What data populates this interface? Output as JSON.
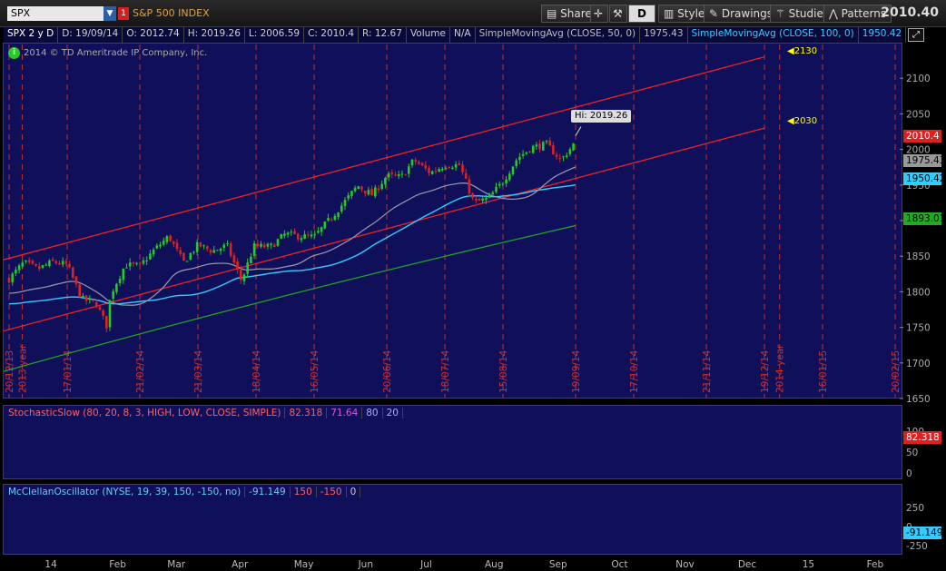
{
  "toolbar": {
    "symbol": "SPX",
    "symbol_name": "S&P 500 INDEX",
    "link_badge": "1",
    "share_label": "Share",
    "period_label": "D",
    "style_label": "Style",
    "drawings_label": "Drawings",
    "studies_label": "Studies",
    "patterns_label": "Patterns",
    "last_price": "2010.40"
  },
  "info": {
    "title": "SPX 2 y D",
    "date": "D: 19/09/14",
    "open": "O: 2012.74",
    "high": "H: 2019.26",
    "low": "L: 2006.59",
    "close": "C: 2010.4",
    "range": "R: 12.67",
    "volume_label": "Volume",
    "volume_value": "N/A",
    "sma50_label": "SimpleMovingAvg (CLOSE, 50, 0)",
    "sma50_value": "1975.43",
    "sma100_label": "SimpleMovingAvg (CLOSE, 100, 0)",
    "sma100_value": "1950.42",
    "more": "...",
    "copyright": "2014 © TD Ameritrade IP Company, Inc."
  },
  "colors": {
    "panel_bg": "#10105a",
    "up_candle": "#22cc22",
    "down_candle": "#dd2222",
    "channel": "#ff2020",
    "sma50": "#9a9ab0",
    "sma100": "#33ccff",
    "sma200": "#22aa22",
    "stoch_k": "#ff3030",
    "stoch_d": "#cc44cc",
    "mcclellan": "#33bbdd"
  },
  "chart_data": [
    {
      "type": "candlestick",
      "ylim": [
        1650,
        2150
      ],
      "y_ticks": [
        1650,
        1700,
        1750,
        1800,
        1850,
        1900,
        1950,
        2000,
        2050,
        2100
      ],
      "date_labels": [
        "20/12/13",
        "17/01/14",
        "21/02/14",
        "21/03/14",
        "18/04/14",
        "16/05/14",
        "20/06/14",
        "18/07/14",
        "15/08/14",
        "19/09/14",
        "17/10/14",
        "21/11/14",
        "19/12/14",
        "16/01/15",
        "20/02/15"
      ],
      "year_labels": [
        "2013 year",
        "2014 year"
      ],
      "close_series": [
        [
          "2013-12-20",
          1818
        ],
        [
          "2013-12-27",
          1841
        ],
        [
          "2014-01-03",
          1832
        ],
        [
          "2014-01-10",
          1842
        ],
        [
          "2014-01-17",
          1838
        ],
        [
          "2014-01-24",
          1790
        ],
        [
          "2014-01-31",
          1783
        ],
        [
          "2014-02-05",
          1752
        ],
        [
          "2014-02-07",
          1797
        ],
        [
          "2014-02-14",
          1838
        ],
        [
          "2014-02-21",
          1836
        ],
        [
          "2014-02-28",
          1859
        ],
        [
          "2014-03-07",
          1878
        ],
        [
          "2014-03-14",
          1841
        ],
        [
          "2014-03-21",
          1866
        ],
        [
          "2014-03-28",
          1857
        ],
        [
          "2014-04-04",
          1865
        ],
        [
          "2014-04-11",
          1815
        ],
        [
          "2014-04-17",
          1864
        ],
        [
          "2014-04-25",
          1863
        ],
        [
          "2014-05-02",
          1881
        ],
        [
          "2014-05-09",
          1878
        ],
        [
          "2014-05-16",
          1877
        ],
        [
          "2014-05-23",
          1900
        ],
        [
          "2014-05-30",
          1924
        ],
        [
          "2014-06-06",
          1949
        ],
        [
          "2014-06-13",
          1936
        ],
        [
          "2014-06-20",
          1963
        ],
        [
          "2014-06-27",
          1961
        ],
        [
          "2014-07-03",
          1985
        ],
        [
          "2014-07-11",
          1967
        ],
        [
          "2014-07-18",
          1978
        ],
        [
          "2014-07-25",
          1978
        ],
        [
          "2014-08-01",
          1925
        ],
        [
          "2014-08-08",
          1931
        ],
        [
          "2014-08-15",
          1955
        ],
        [
          "2014-08-22",
          1988
        ],
        [
          "2014-08-29",
          2003
        ],
        [
          "2014-09-05",
          2007
        ],
        [
          "2014-09-12",
          1985
        ],
        [
          "2014-09-19",
          2010.4
        ]
      ],
      "high_marker": 2019.26,
      "annotations": [
        "Hi: 2019.26",
        "2130",
        "2030"
      ],
      "price_tags": [
        "2010.4",
        "1975.43",
        "1950.42",
        "1893.01"
      ],
      "series": [
        {
          "name": "SimpleMovingAvg (CLOSE, 50, 0)",
          "last": 1975.43
        },
        {
          "name": "SimpleMovingAvg (CLOSE, 100, 0)",
          "last": 1950.42
        },
        {
          "name": "",
          "last": 1893.01
        }
      ],
      "channel_upper_at_2014_12_19": 2130,
      "channel_lower_at_2014_12_19": 2030,
      "grid": false
    },
    {
      "type": "line",
      "name": "StochasticSlow (80, 20, 8, 3, HIGH, LOW, CLOSE, SIMPLE)",
      "values_label": [
        "82.318",
        "71.64",
        "80",
        "20"
      ],
      "ylim": [
        0,
        100
      ],
      "y_ticks": [
        0,
        50,
        100
      ],
      "levels": [
        80,
        20
      ],
      "last_k": 82.318,
      "last_d": 71.64
    },
    {
      "type": "line",
      "name": "McClellanOscillator (NYSE, 19, 39, 150, -150, no)",
      "values_label": [
        "-91.149",
        "150",
        "-150",
        "0"
      ],
      "ylim": [
        -300,
        300
      ],
      "y_ticks": [
        -250,
        0,
        250
      ],
      "levels": [
        150,
        -150,
        0
      ],
      "last": -91.149
    }
  ],
  "x_axis": {
    "labels": [
      "14",
      "Feb",
      "Mar",
      "Apr",
      "May",
      "Jun",
      "Jul",
      "Aug",
      "Sep",
      "Oct",
      "Nov",
      "Dec",
      "15",
      "Feb"
    ]
  }
}
